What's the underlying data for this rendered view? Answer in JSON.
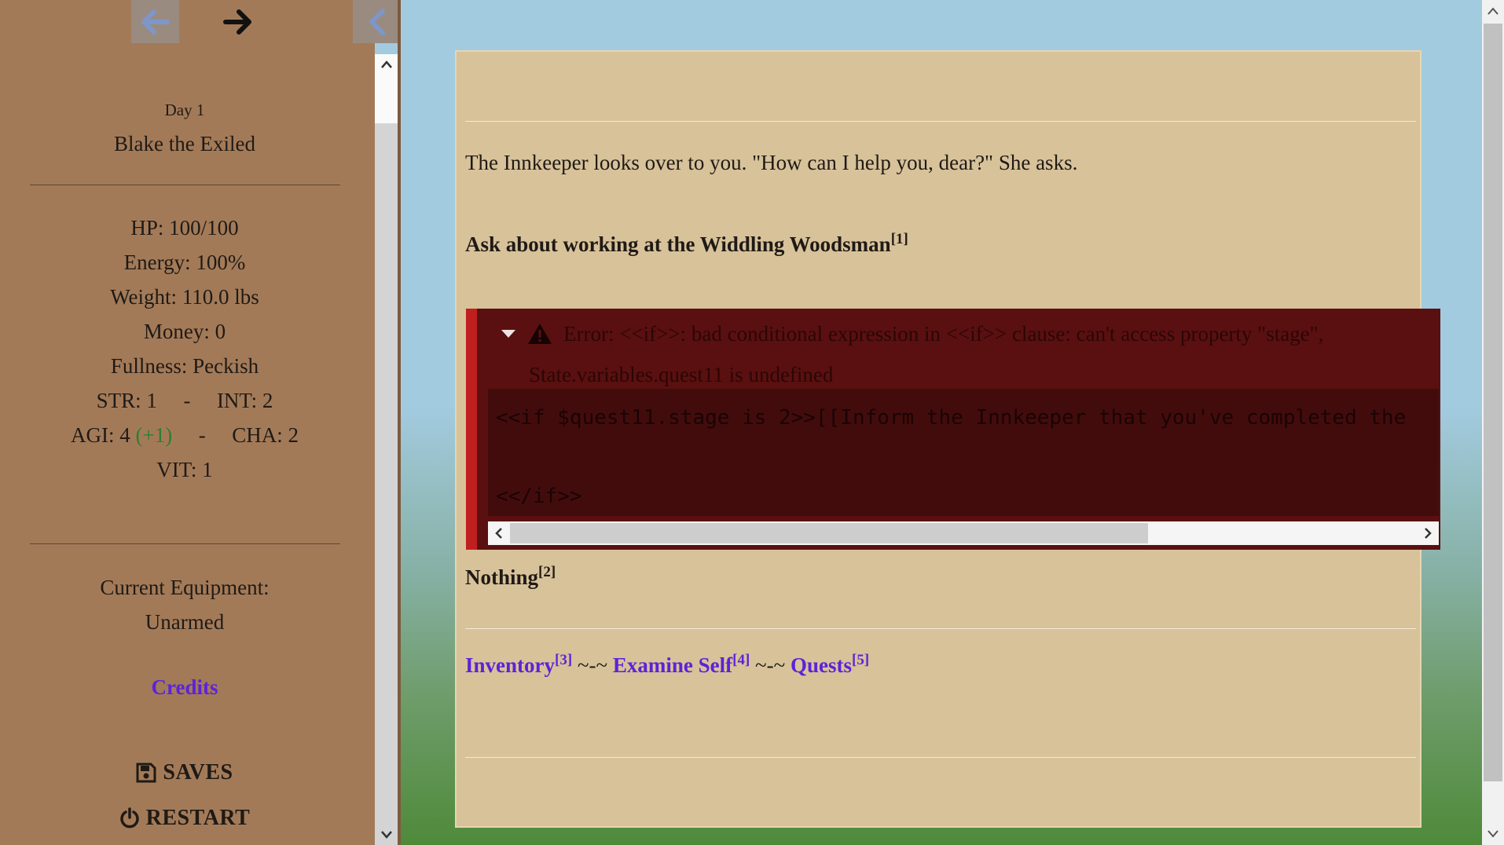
{
  "sidebar": {
    "day": "Day 1",
    "character_name": "Blake the Exiled",
    "stats": {
      "hp": "HP: 100/100",
      "energy": "Energy: 100%",
      "weight": "Weight: 110.0 lbs",
      "money": "Money: 0",
      "fullness": "Fullness: Peckish",
      "str": "STR: 1",
      "int": "INT: 2",
      "agi": "AGI: 4",
      "agi_bonus": "(+1)",
      "cha": "CHA: 2",
      "vit": "VIT: 1",
      "separator": "-"
    },
    "equipment_label": "Current Equipment:",
    "equipment_value": "Unarmed",
    "credits_label": "Credits",
    "saves_label": "SAVES",
    "restart_label": "RESTART"
  },
  "passage": {
    "innkeeper_text": "The Innkeeper looks over to you. \"How can I help you, dear?\" She asks.",
    "link_work": "Ask about working at the Widdling Woodsman",
    "link_work_key": "[1]",
    "link_nothing": "Nothing",
    "link_nothing_key": "[2]",
    "link_inventory": "Inventory",
    "link_inventory_key": "[3]",
    "link_examine": "Examine Self",
    "link_examine_key": "[4]",
    "link_quests": "Quests",
    "link_quests_key": "[5]",
    "nav_separator": " ~-~ "
  },
  "error": {
    "message_line1": "Error: <<if>>: bad conditional expression in <<if>> clause: can't access property \"stage\",",
    "message_line2": "State.variables.quest11 is undefined",
    "code_line1": "<<if $quest11.stage is 2>>[[Inform the Innkeeper that you've completed the",
    "code_line2": "<</if>>"
  },
  "colors": {
    "sidebar_bg": "#a37a58",
    "passage_bg": "#d8c29a",
    "link": "#5b23d8",
    "error_bg": "#5a1010",
    "error_accent": "#c01f1f",
    "bonus": "#2e7d32"
  },
  "icons": [
    "arrow-left-icon",
    "arrow-right-icon",
    "chevron-left-icon",
    "floppy-disk-icon",
    "power-icon",
    "warning-triangle-icon",
    "caret-down-icon"
  ]
}
